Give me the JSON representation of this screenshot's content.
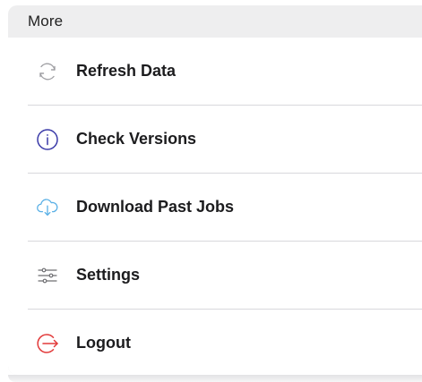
{
  "menu": {
    "header": "More",
    "items": [
      {
        "label": "Refresh Data",
        "icon": "refresh-icon"
      },
      {
        "label": "Check Versions",
        "icon": "info-icon"
      },
      {
        "label": "Download Past Jobs",
        "icon": "cloud-download-icon"
      },
      {
        "label": "Settings",
        "icon": "sliders-icon"
      },
      {
        "label": "Logout",
        "icon": "logout-icon"
      }
    ]
  },
  "colors": {
    "text": "#1c1c1e",
    "info_icon": "#3a3aa8",
    "cloud_icon": "#5ab0e6",
    "logout_icon": "#e23a3a",
    "muted_icon": "#9a9a9e"
  }
}
